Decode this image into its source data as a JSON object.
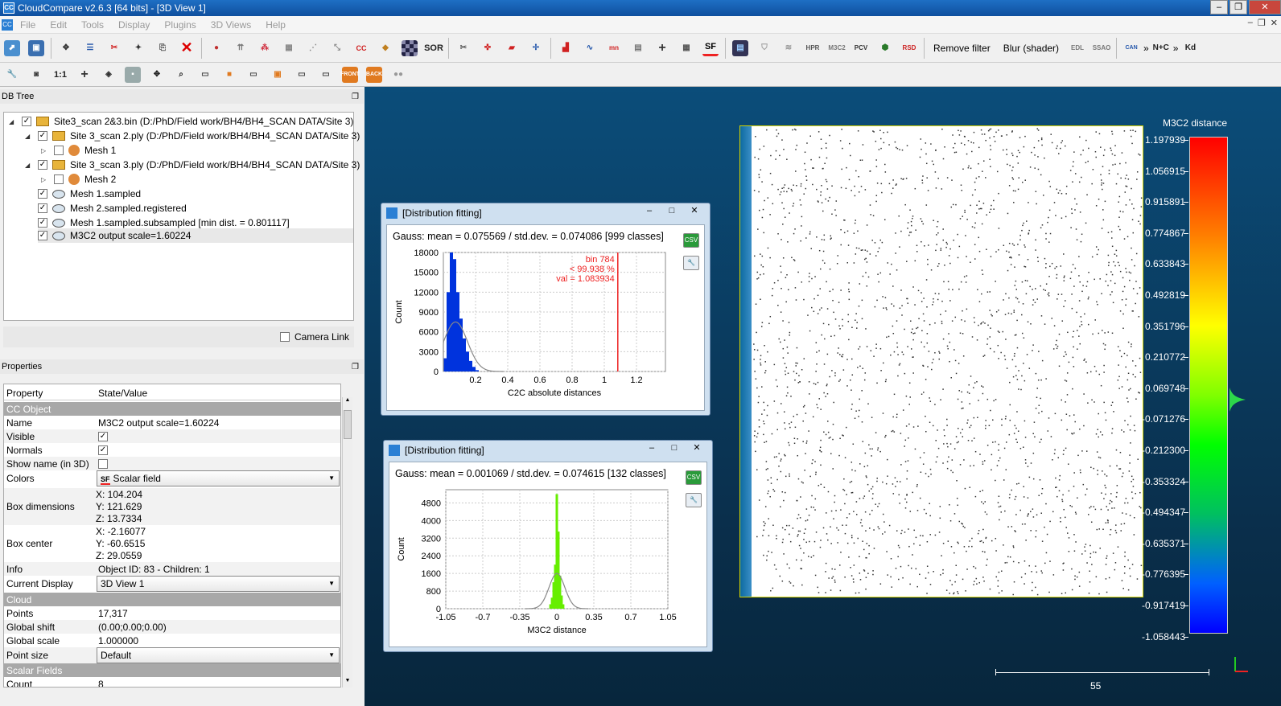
{
  "window": {
    "title": "CloudCompare v2.6.3 [64 bits] - [3D View 1]"
  },
  "menu": [
    "File",
    "Edit",
    "Tools",
    "Display",
    "Plugins",
    "3D Views",
    "Help"
  ],
  "toolbar": {
    "remove_filter": "Remove filter",
    "blur_shader": "Blur (shader)",
    "sf_label": "SF",
    "sor_label": "SOR",
    "cc_label": "CC",
    "front_label": "FRONT",
    "back_label": "BACK",
    "one_to_one": "1:1",
    "kd_label": "Kd",
    "ntc_label": "N+C"
  },
  "db_tree": {
    "title": "DB Tree",
    "items": [
      {
        "label": "Site3_scan 2&3.bin (D:/PhD/Field work/BH4/BH4_SCAN DATA/Site 3)",
        "checked": true
      },
      {
        "label": "Site 3_scan 2.ply (D:/PhD/Field work/BH4/BH4_SCAN DATA/Site 3)",
        "checked": true
      },
      {
        "label": "Mesh 1",
        "checked": false
      },
      {
        "label": "Site 3_scan 3.ply (D:/PhD/Field work/BH4/BH4_SCAN DATA/Site 3)",
        "checked": true
      },
      {
        "label": "Mesh 2",
        "checked": false
      },
      {
        "label": "Mesh 1.sampled",
        "checked": true
      },
      {
        "label": "Mesh 2.sampled.registered",
        "checked": true
      },
      {
        "label": "Mesh 1.sampled.subsampled [min dist. = 0.801117]",
        "checked": true
      },
      {
        "label": "M3C2 output scale=1.60224",
        "checked": true
      }
    ],
    "camera_link": "Camera Link"
  },
  "properties": {
    "title": "Properties",
    "col_property": "Property",
    "col_value": "State/Value",
    "sec_cc": "CC Object",
    "name_k": "Name",
    "name_v": "M3C2 output scale=1.60224",
    "visible_k": "Visible",
    "normals_k": "Normals",
    "showname_k": "Show name (in 3D)",
    "colors_k": "Colors",
    "colors_v": "Scalar field",
    "colors_icon": "SF",
    "boxdim_k": "Box dimensions",
    "boxdim_x": "X: 104.204",
    "boxdim_y": "Y: 121.629",
    "boxdim_z": "Z: 13.7334",
    "boxc_k": "Box center",
    "boxc_x": "X: -2.16077",
    "boxc_y": "Y: -60.6515",
    "boxc_z": "Z: 29.0559",
    "info_k": "Info",
    "info_v": "Object ID: 83 - Children: 1",
    "curdisp_k": "Current Display",
    "curdisp_v": "3D View 1",
    "sec_cloud": "Cloud",
    "points_k": "Points",
    "points_v": "17,317",
    "gshift_k": "Global shift",
    "gshift_v": "(0.00;0.00;0.00)",
    "gscale_k": "Global scale",
    "gscale_v": "1.000000",
    "psize_k": "Point size",
    "psize_v": "Default",
    "sec_sf": "Scalar Fields",
    "count_k": "Count",
    "count_v": "8"
  },
  "dialog1": {
    "title": "[Distribution fitting]",
    "heading": "Gauss: mean = 0.075569 / std.dev. = 0.074086 [999 classes]",
    "annot": [
      "bin 784",
      "< 99.938 %",
      "val = 1.083934"
    ],
    "csv": "CSV"
  },
  "dialog2": {
    "title": "[Distribution fitting]",
    "heading": "Gauss: mean = 0.001069 / std.dev. = 0.074615 [132 classes]",
    "csv": "CSV"
  },
  "chart_data": [
    {
      "type": "bar",
      "title": "",
      "xlabel": "C2C absolute distances",
      "ylabel": "Count",
      "xticks": [
        "0.2",
        "0.4",
        "0.6",
        "0.8",
        "1",
        "1.2"
      ],
      "yticks": [
        "0",
        "3000",
        "6000",
        "9000",
        "12000",
        "15000",
        "18000"
      ],
      "xlim": [
        0,
        1.38
      ],
      "ylim": [
        0,
        18000
      ],
      "x": [
        0.01,
        0.03,
        0.05,
        0.07,
        0.09,
        0.11,
        0.13,
        0.15,
        0.17,
        0.19,
        0.21
      ],
      "values": [
        2000,
        12000,
        19000,
        17000,
        12000,
        8000,
        5000,
        3000,
        1600,
        700,
        200
      ],
      "gauss": {
        "mean": 0.075569,
        "std": 0.074086,
        "peak": 7500
      },
      "threshold": 1.083934,
      "color": "#0033dd"
    },
    {
      "type": "bar",
      "title": "",
      "xlabel": "M3C2 distance",
      "ylabel": "Count",
      "xticks": [
        "-1.05",
        "-0.7",
        "-0.35",
        "0",
        "0.35",
        "0.7",
        "1.05"
      ],
      "yticks": [
        "0",
        "800",
        "1600",
        "2400",
        "3200",
        "4000",
        "4800"
      ],
      "xlim": [
        -1.05,
        1.05
      ],
      "ylim": [
        0,
        5400
      ],
      "x": [
        -0.06,
        -0.045,
        -0.03,
        -0.015,
        0,
        0.015,
        0.03,
        0.045,
        0.06
      ],
      "values": [
        200,
        500,
        1200,
        2000,
        5200,
        3500,
        1500,
        600,
        200
      ],
      "gauss": {
        "mean": 0.001069,
        "std": 0.074615,
        "peak": 1600
      },
      "color": "#66ee00"
    }
  ],
  "view3d": {
    "scale_title": "M3C2 distance",
    "scale_labels": [
      "1.197939",
      "1.056915",
      "0.915891",
      "0.774867",
      "0.633843",
      "0.492819",
      "0.351796",
      "0.210772",
      "0.069748",
      "-0.071276",
      "-0.212300",
      "-0.353324",
      "-0.494347",
      "-0.635371",
      "-0.776395",
      "-0.917419",
      "-1.058443"
    ],
    "scalebar_value": "55"
  }
}
